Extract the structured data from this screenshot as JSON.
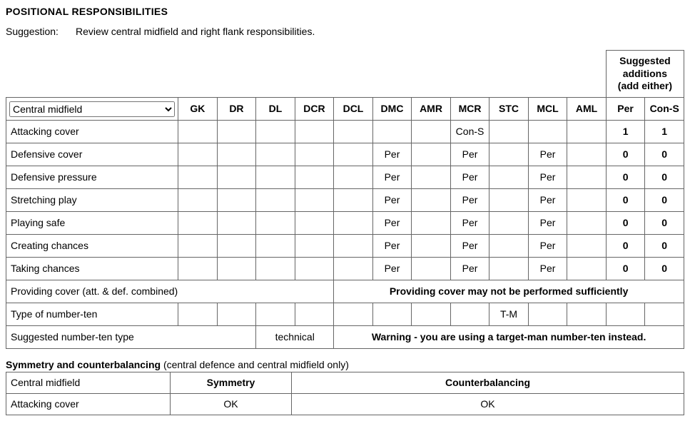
{
  "section_title": "POSITIONAL RESPONSIBILITIES",
  "suggestion": {
    "label": "Suggestion:",
    "text": "Review central midfield and right flank responsibilities."
  },
  "dropdown": {
    "selected": "Central midfield",
    "options": [
      "Central midfield"
    ]
  },
  "suggested_header": {
    "line1": "Suggested",
    "line2": "additions",
    "line3": "(add either)"
  },
  "positions": [
    "GK",
    "DR",
    "DL",
    "DCR",
    "DCL",
    "DMC",
    "AMR",
    "MCR",
    "STC",
    "MCL",
    "AML"
  ],
  "sugg_cols": [
    "Per",
    "Con-S"
  ],
  "rows": [
    {
      "label": "Attacking cover",
      "cells": [
        "",
        "",
        "",
        "",
        "",
        "",
        "",
        "Con-S",
        "",
        "",
        ""
      ],
      "per": "1",
      "cons": "1"
    },
    {
      "label": "Defensive cover",
      "cells": [
        "",
        "",
        "",
        "",
        "",
        "Per",
        "",
        "Per",
        "",
        "Per",
        ""
      ],
      "per": "0",
      "cons": "0"
    },
    {
      "label": "Defensive pressure",
      "cells": [
        "",
        "",
        "",
        "",
        "",
        "Per",
        "",
        "Per",
        "",
        "Per",
        ""
      ],
      "per": "0",
      "cons": "0"
    },
    {
      "label": "Stretching play",
      "cells": [
        "",
        "",
        "",
        "",
        "",
        "Per",
        "",
        "Per",
        "",
        "Per",
        ""
      ],
      "per": "0",
      "cons": "0"
    },
    {
      "label": "Playing safe",
      "cells": [
        "",
        "",
        "",
        "",
        "",
        "Per",
        "",
        "Per",
        "",
        "Per",
        ""
      ],
      "per": "0",
      "cons": "0"
    },
    {
      "label": "Creating chances",
      "cells": [
        "",
        "",
        "",
        "",
        "",
        "Per",
        "",
        "Per",
        "",
        "Per",
        ""
      ],
      "per": "0",
      "cons": "0"
    },
    {
      "label": "Taking chances",
      "cells": [
        "",
        "",
        "",
        "",
        "",
        "Per",
        "",
        "Per",
        "",
        "Per",
        ""
      ],
      "per": "0",
      "cons": "0"
    }
  ],
  "providing_cover": {
    "label": "Providing cover (att. & def. combined)",
    "message": "Providing cover may not be performed sufficiently"
  },
  "type_ten": {
    "label": "Type of number-ten",
    "cells": [
      "",
      "",
      "",
      "",
      "",
      "",
      "",
      "",
      "T-M",
      "",
      ""
    ],
    "per": "",
    "cons": ""
  },
  "suggested_ten": {
    "label": "Suggested number-ten type",
    "value": "technical",
    "message": "Warning - you are using a target-man number-ten instead."
  },
  "symmetry": {
    "title_bold": "Symmetry and counterbalancing",
    "title_rest": " (central defence and central midfield only)",
    "header": {
      "group": "Central midfield",
      "sym": "Symmetry",
      "cb": "Counterbalancing"
    },
    "rows": [
      {
        "label": "Attacking cover",
        "sym": "OK",
        "cb": "OK"
      }
    ]
  }
}
